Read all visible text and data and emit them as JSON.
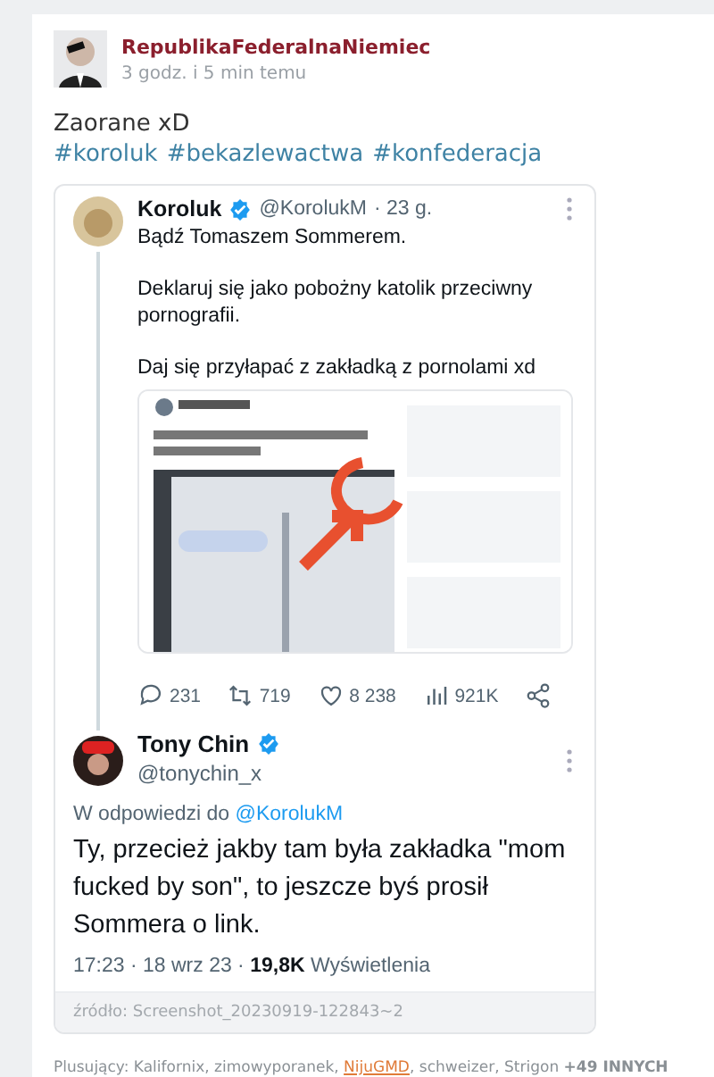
{
  "post": {
    "author": "RepublikaFederalnaNiemiec",
    "time": "3 godz. i 5 min temu",
    "text": "Zaorane xD",
    "tags": [
      "#koroluk",
      "#bekazlewactwa",
      "#konfederacja"
    ]
  },
  "tweet": {
    "name": "Koroluk",
    "verified": true,
    "handle": "@KorolukM",
    "age": "· 23 g.",
    "paragraphs": [
      "Bądź Tomaszem Sommerem.",
      "Deklaruj się jako pobożny katolik przeciwny pornografii.",
      "Daj się przyłapać z zakładką z pornolami xd"
    ],
    "stats": [
      {
        "kind": "reply",
        "value": "231"
      },
      {
        "kind": "retweet",
        "value": "719"
      },
      {
        "kind": "like",
        "value": "8 238"
      },
      {
        "kind": "views",
        "value": "921K"
      },
      {
        "kind": "share"
      }
    ]
  },
  "reply": {
    "name": "Tony Chin",
    "verified": true,
    "handle": "@tonychin_x",
    "in_reply_to": "W odpowiedzi do",
    "in_reply_to_handle": "@KorolukM",
    "text": "Ty, przecież jakby tam była zakładka \"mom fucked by son\", to jeszcze byś prosił Sommera o link.",
    "meta": "17:23 · 18 wrz 23 · **19,8K** Wyświetlenia"
  },
  "source": "źródło: Screenshot_20230919-122843~2",
  "voters": {
    "label": "Plusujący:",
    "names": [
      {
        "name": "Kalifornix",
        "highlighted": false
      },
      {
        "name": "zimowyporanek",
        "highlighted": false
      },
      {
        "name": "NijuGMD",
        "highlighted": true
      },
      {
        "name": "schweizer",
        "highlighted": false
      },
      {
        "name": "Strigon",
        "highlighted": false
      }
    ],
    "separator": ",",
    "more": "+49 INNYCH"
  }
}
